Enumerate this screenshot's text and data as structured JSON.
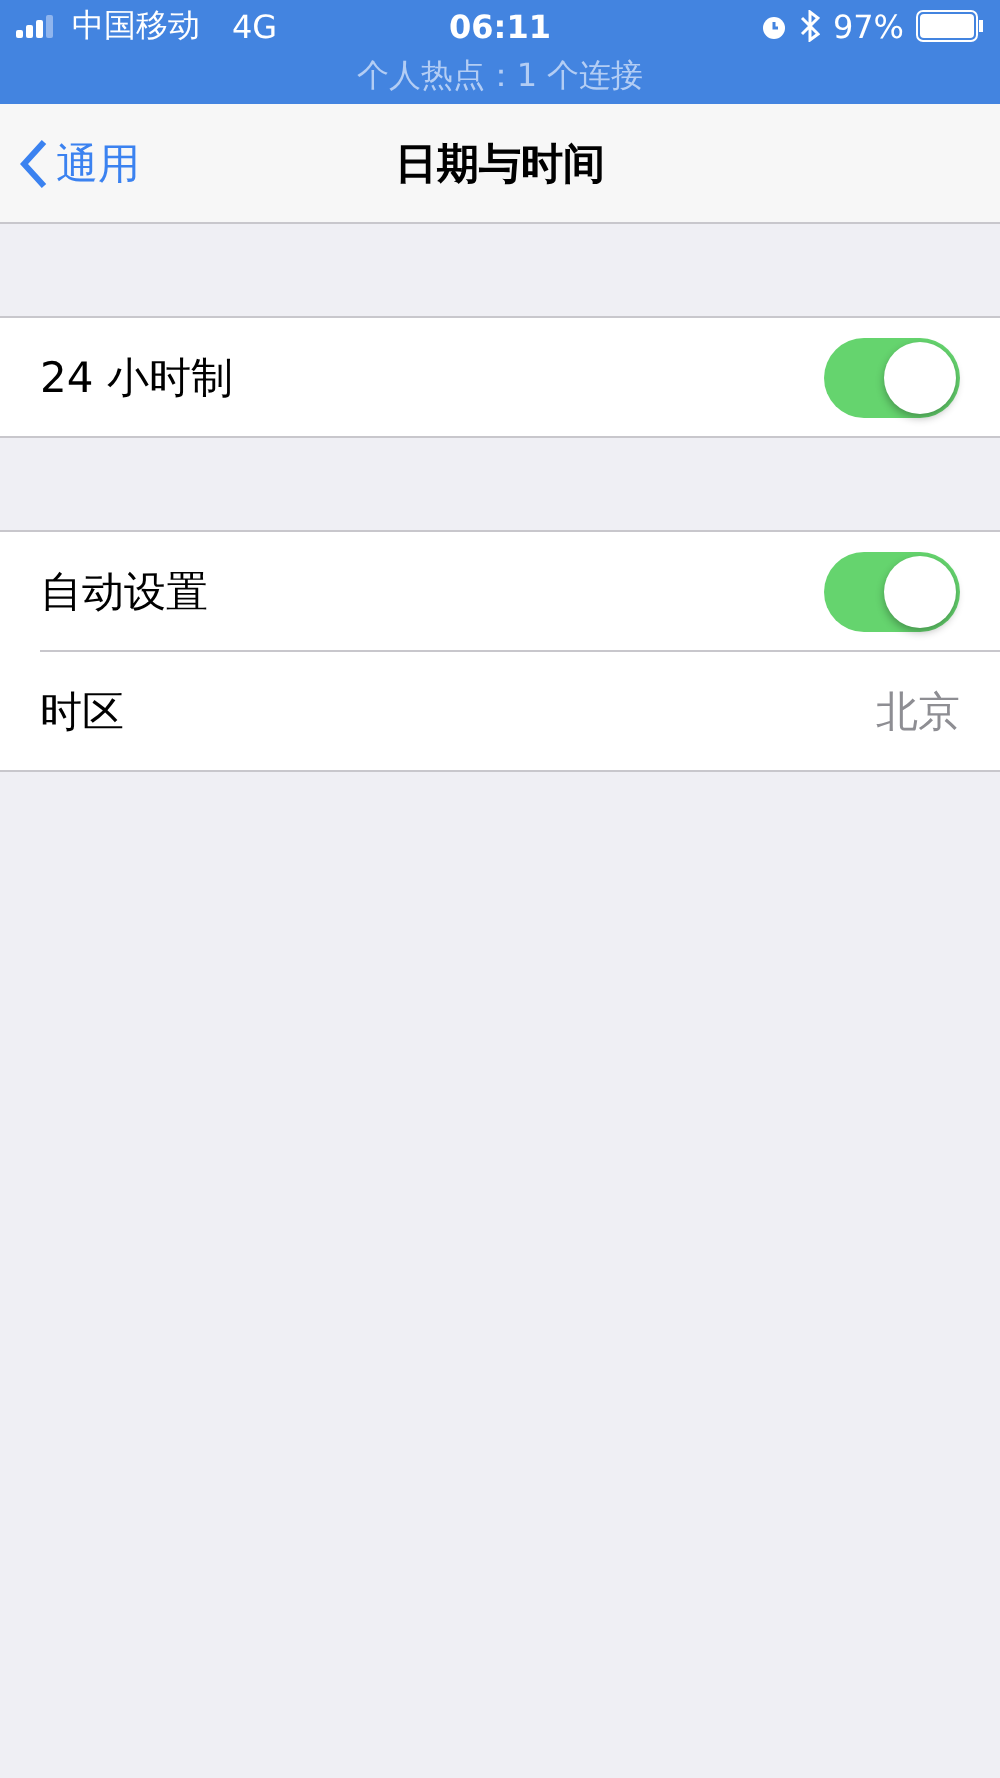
{
  "status_bar": {
    "carrier": "中国移动",
    "network": "4G",
    "time": "06:11",
    "battery": "97%",
    "hotspot": "个人热点：1 个连接"
  },
  "nav": {
    "back": "通用",
    "title": "日期与时间"
  },
  "groups": [
    {
      "rows": [
        {
          "kind": "toggle",
          "label": "24 小时制",
          "on": true
        }
      ]
    },
    {
      "rows": [
        {
          "kind": "toggle",
          "label": "自动设置",
          "on": true
        },
        {
          "kind": "value",
          "label": "时区",
          "value": "北京"
        }
      ]
    }
  ]
}
